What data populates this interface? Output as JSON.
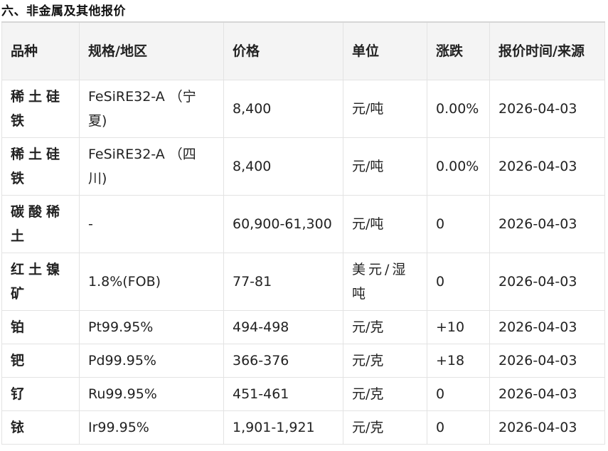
{
  "section": {
    "title": "六、非金属及其他报价"
  },
  "table": {
    "headers": {
      "variety": "品种",
      "spec": "规格/地区",
      "price": "价格",
      "unit": "单位",
      "change": "涨跌",
      "source": "报价时间/来源"
    },
    "rows": [
      {
        "variety": "稀土硅铁",
        "spec": "FeSiRE32-A （宁夏)",
        "price": "8,400",
        "unit": "元/吨",
        "change": "0.00%",
        "date": "2026-04-03"
      },
      {
        "variety": "稀土硅铁",
        "spec": "FeSiRE32-A （四川)",
        "price": "8,400",
        "unit": "元/吨",
        "change": "0.00%",
        "date": "2026-04-03"
      },
      {
        "variety": "碳酸稀土",
        "spec": "-",
        "price": "60,900-61,300",
        "unit": "元/吨",
        "change": "0",
        "date": "2026-04-03"
      },
      {
        "variety": "红土镍矿",
        "spec": "1.8%(FOB)",
        "price": "77-81",
        "unit": "美元/湿吨",
        "change": "0",
        "date": "2026-04-03"
      },
      {
        "variety": "铂",
        "spec": "Pt99.95%",
        "price": "494-498",
        "unit": "元/克",
        "change": "+10",
        "date": "2026-04-03"
      },
      {
        "variety": "钯",
        "spec": "Pd99.95%",
        "price": "366-376",
        "unit": "元/克",
        "change": "+18",
        "date": "2026-04-03"
      },
      {
        "variety": "钌",
        "spec": "Ru99.95%",
        "price": "451-461",
        "unit": "元/克",
        "change": "0",
        "date": "2026-04-03"
      },
      {
        "variety": "铱",
        "spec": "Ir99.95%",
        "price": "1,901-1,921",
        "unit": "元/克",
        "change": "0",
        "date": "2026-04-03"
      }
    ]
  }
}
